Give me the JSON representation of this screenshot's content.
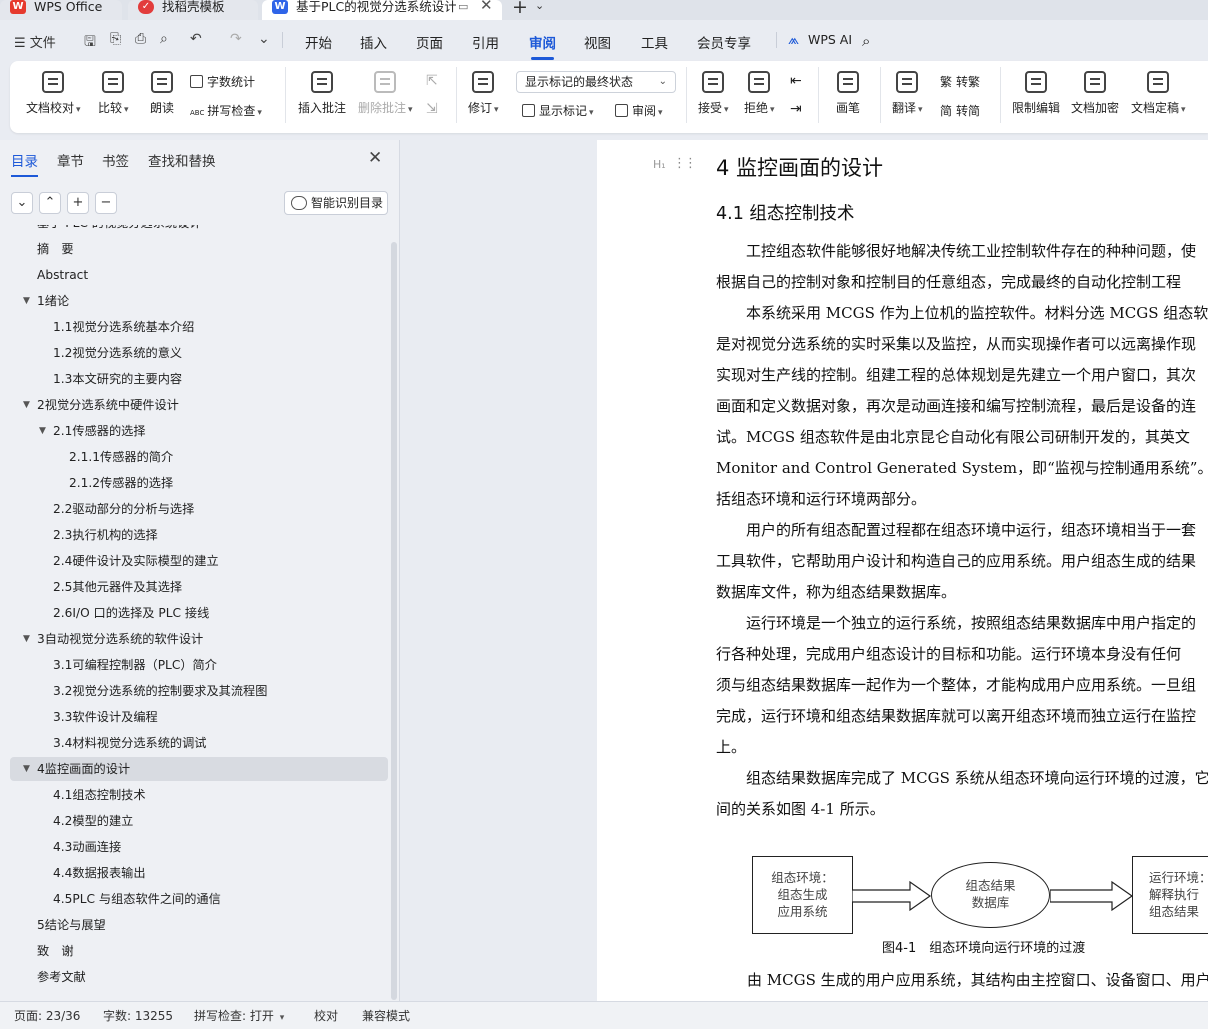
{
  "tabs": {
    "wps": "WPS Office",
    "template": "找稻壳模板",
    "document": "基于PLC的视觉分选系统设计",
    "document_overflow": "基于PLC的视觉分选系统设计：",
    "add": "+"
  },
  "menu": {
    "file": "☰ 文件",
    "items": [
      "开始",
      "插入",
      "页面",
      "引用",
      "审阅",
      "视图",
      "工具",
      "会员专享"
    ],
    "active": "审阅",
    "wps_ai": "WPS AI"
  },
  "ribbon": {
    "doc_check": "文档校对",
    "compare": "比较",
    "read_aloud": "朗读",
    "word_count": "字数统计",
    "spell_check": "拼写检查",
    "insert_comment": "插入批注",
    "delete_comment": "删除批注",
    "revise": "修订",
    "markup_state": "显示标记的最终状态",
    "show_markup": "显示标记",
    "review": "审阅",
    "accept": "接受",
    "reject": "拒绝",
    "pen": "画笔",
    "translate": "翻译",
    "to_traditional": "转繁",
    "to_simplified": "转简",
    "restrict_edit": "限制编辑",
    "doc_encrypt": "文档加密",
    "doc_finalize": "文档定稿",
    "abc": "ABC"
  },
  "panel": {
    "tabs": [
      "目录",
      "章节",
      "书签",
      "查找和替换"
    ],
    "active_tab": "目录",
    "smart_toc": "智能识别目录",
    "toc": [
      {
        "label": "基于 PLC 的视觉分选系统设计",
        "level": 0,
        "toggle": ""
      },
      {
        "label": "摘　要",
        "level": 0,
        "toggle": ""
      },
      {
        "label": "Abstract",
        "level": 0,
        "toggle": ""
      },
      {
        "label": "1绪论",
        "level": 0,
        "toggle": "▼"
      },
      {
        "label": "1.1视觉分选系统基本介绍",
        "level": 1,
        "toggle": ""
      },
      {
        "label": "1.2视觉分选系统的意义",
        "level": 1,
        "toggle": ""
      },
      {
        "label": "1.3本文研究的主要内容",
        "level": 1,
        "toggle": ""
      },
      {
        "label": "2视觉分选系统中硬件设计",
        "level": 0,
        "toggle": "▼"
      },
      {
        "label": "2.1传感器的选择",
        "level": 1,
        "toggle": "▼"
      },
      {
        "label": "2.1.1传感器的简介",
        "level": 2,
        "toggle": ""
      },
      {
        "label": "2.1.2传感器的选择",
        "level": 2,
        "toggle": ""
      },
      {
        "label": "2.2驱动部分的分析与选择",
        "level": 1,
        "toggle": ""
      },
      {
        "label": "2.3执行机构的选择",
        "level": 1,
        "toggle": ""
      },
      {
        "label": "2.4硬件设计及实际模型的建立",
        "level": 1,
        "toggle": ""
      },
      {
        "label": "2.5其他元器件及其选择",
        "level": 1,
        "toggle": ""
      },
      {
        "label": "2.6I/O 口的选择及 PLC 接线",
        "level": 1,
        "toggle": ""
      },
      {
        "label": "3自动视觉分选系统的软件设计",
        "level": 0,
        "toggle": "▼"
      },
      {
        "label": "3.1可编程控制器（PLC）简介",
        "level": 1,
        "toggle": ""
      },
      {
        "label": "3.2视觉分选系统的控制要求及其流程图",
        "level": 1,
        "toggle": ""
      },
      {
        "label": "3.3软件设计及编程",
        "level": 1,
        "toggle": ""
      },
      {
        "label": "3.4材料视觉分选系统的调试",
        "level": 1,
        "toggle": ""
      },
      {
        "label": "4监控画面的设计",
        "level": 0,
        "toggle": "▼"
      },
      {
        "label": "4.1组态控制技术",
        "level": 1,
        "toggle": ""
      },
      {
        "label": "4.2模型的建立",
        "level": 1,
        "toggle": ""
      },
      {
        "label": "4.3动画连接",
        "level": 1,
        "toggle": ""
      },
      {
        "label": "4.4数据报表输出",
        "level": 1,
        "toggle": ""
      },
      {
        "label": "4.5PLC 与组态软件之间的通信",
        "level": 1,
        "toggle": ""
      },
      {
        "label": "5结论与展望",
        "level": 0,
        "toggle": ""
      },
      {
        "label": "致　谢",
        "level": 0,
        "toggle": ""
      },
      {
        "label": "参考文献",
        "level": 0,
        "toggle": ""
      }
    ],
    "selected_index": 21
  },
  "document": {
    "heading1": "4  监控画面的设计",
    "heading2": "4.1  组态控制技术",
    "lines": [
      "　　工控组态软件能够很好地解决传统工业控制软件存在的种种问题，使",
      "根据自己的控制对象和控制目的任意组态，完成最终的自动化控制工程",
      "　　本系统采用 MCGS 作为上位机的监控软件。材料分选 MCGS 组态软",
      "是对视觉分选系统的实时采集以及监控，从而实现操作者可以远离操作现",
      "实现对生产线的控制。组建工程的总体规划是先建立一个用户窗口，其次",
      "画面和定义数据对象，再次是动画连接和编写控制流程，最后是设备的连",
      "试。MCGS 组态软件是由北京昆仑自动化有限公司研制开发的，其英文",
      "Monitor and Control Generated System，即“监视与控制通用系统”。MCGS",
      "括组态环境和运行环境两部分。",
      "　　用户的所有组态配置过程都在组态环境中运行，组态环境相当于一套",
      "工具软件，它帮助用户设计和构造自己的应用系统。用户组态生成的结果",
      "数据库文件，称为组态结果数据库。",
      "　　运行环境是一个独立的运行系统，按照组态结果数据库中用户指定的",
      "行各种处理，完成用户组态设计的目标和功能。运行环境本身没有任何",
      "须与组态结果数据库一起作为一个整体，才能构成用户应用系统。一旦组",
      "完成，运行环境和组态结果数据库就可以离开组态环境而独立运行在监控",
      "上。",
      "　　组态结果数据库完成了 MCGS 系统从组态环境向运行环境的过渡，它",
      "间的关系如图 4-1 所示。"
    ],
    "figure": {
      "box1": [
        "组态环境：",
        "组态生成",
        "应用系统"
      ],
      "ellipse": [
        "组态结果",
        "数据库"
      ],
      "box2": [
        "运行环境：",
        "解释执行",
        "组态结果"
      ],
      "caption": "图4-1　组态环境向运行环境的过渡"
    },
    "after_figure": "　由 MCGS 生成的用户应用系统，其结构由主控窗口、设备窗口、用户"
  },
  "status": {
    "page": "页面: 23/36",
    "words": "字数: 13255",
    "spell": "拼写检查: 打开",
    "proof": "校对",
    "compat": "兼容模式"
  },
  "colors": {
    "accent": "#1d59d8",
    "wps_red": "#e63a2e",
    "doc_blue": "#2f64e8"
  }
}
